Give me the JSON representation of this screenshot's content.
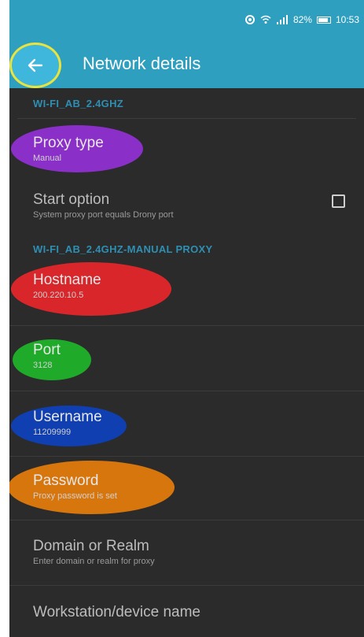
{
  "status_bar": {
    "battery": "82%",
    "time": "10:53"
  },
  "app_bar": {
    "title": "Network details"
  },
  "sections": {
    "wifi_header": "WI-FI_AB_2.4GHZ",
    "proxy_header": "WI-FI_AB_2.4GHZ-MANUAL PROXY"
  },
  "items": {
    "proxy_type": {
      "label": "Proxy type",
      "value": "Manual"
    },
    "start_option": {
      "label": "Start option",
      "value": "System proxy port equals Drony port",
      "checked": false
    },
    "hostname": {
      "label": "Hostname",
      "value": "200.220.10.5"
    },
    "port": {
      "label": "Port",
      "value": "3128"
    },
    "username": {
      "label": "Username",
      "value": "11209999"
    },
    "password": {
      "label": "Password",
      "value": "Proxy password is set"
    },
    "domain": {
      "label": "Domain or Realm",
      "value": "Enter domain or realm for proxy"
    },
    "workstation": {
      "label": "Workstation/device name"
    }
  },
  "colors": {
    "app_bar": "#2f9fc0",
    "background": "#2b2b2b",
    "section_text": "#2e8fb3",
    "highlight_proxy_type": "#8a2fc7",
    "highlight_hostname": "#d8262a",
    "highlight_port": "#1faa2a",
    "highlight_username": "#0f3fb0",
    "highlight_password": "#d8760e",
    "back_ring": "#e9e33d"
  }
}
